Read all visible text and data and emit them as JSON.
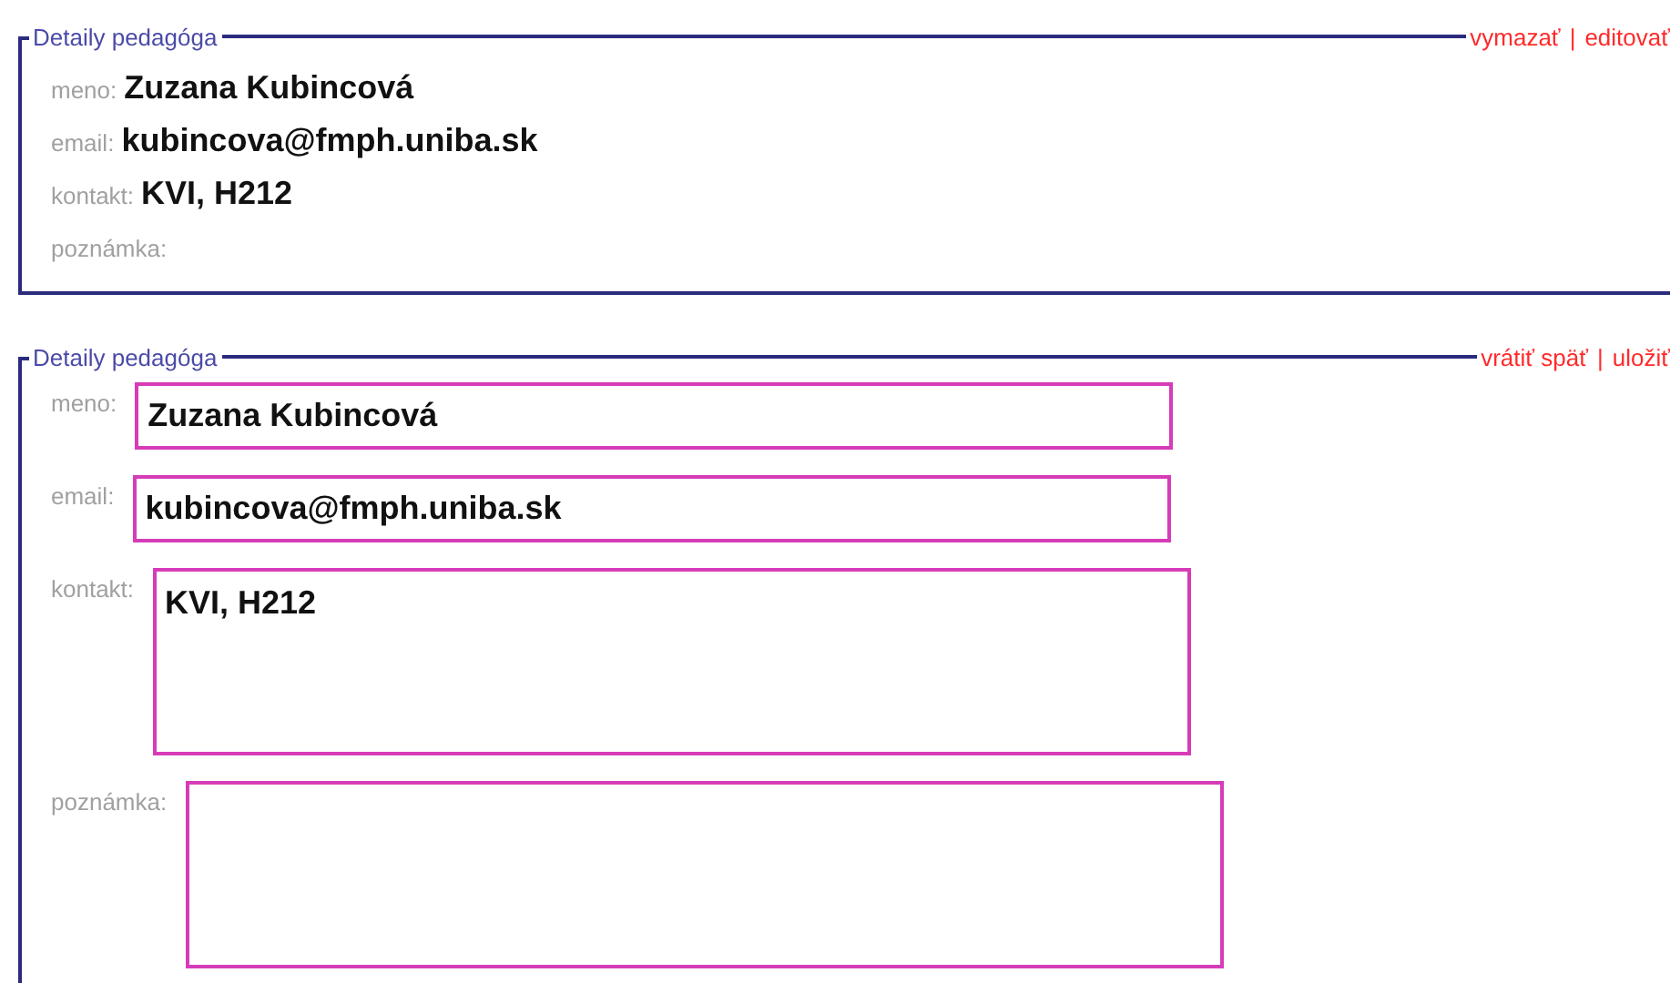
{
  "panels": [
    {
      "kind": "view",
      "title": "Detaily pedagóga",
      "actions": [
        "vymazať",
        "editovať"
      ],
      "separator": "|",
      "fields": [
        {
          "label": "meno:",
          "value": "Zuzana Kubincová"
        },
        {
          "label": "email:",
          "value": "kubincova@fmph.uniba.sk"
        },
        {
          "label": "kontakt:",
          "value": "KVI, H212"
        },
        {
          "label": "poznámka:"
        }
      ]
    },
    {
      "kind": "edit",
      "title": "Detaily pedagóga",
      "actions": [
        "vrátiť späť",
        "uložiť"
      ],
      "separator": "|",
      "fields": [
        {
          "label": "meno:",
          "value": "Zuzana Kubincová",
          "kind": "line"
        },
        {
          "label": "email:",
          "value": "kubincova@fmph.uniba.sk",
          "kind": "line"
        },
        {
          "label": "kontakt:",
          "value": "KVI, H212",
          "kind": "area"
        },
        {
          "label": "poznámka:",
          "kind": "area"
        }
      ]
    }
  ]
}
